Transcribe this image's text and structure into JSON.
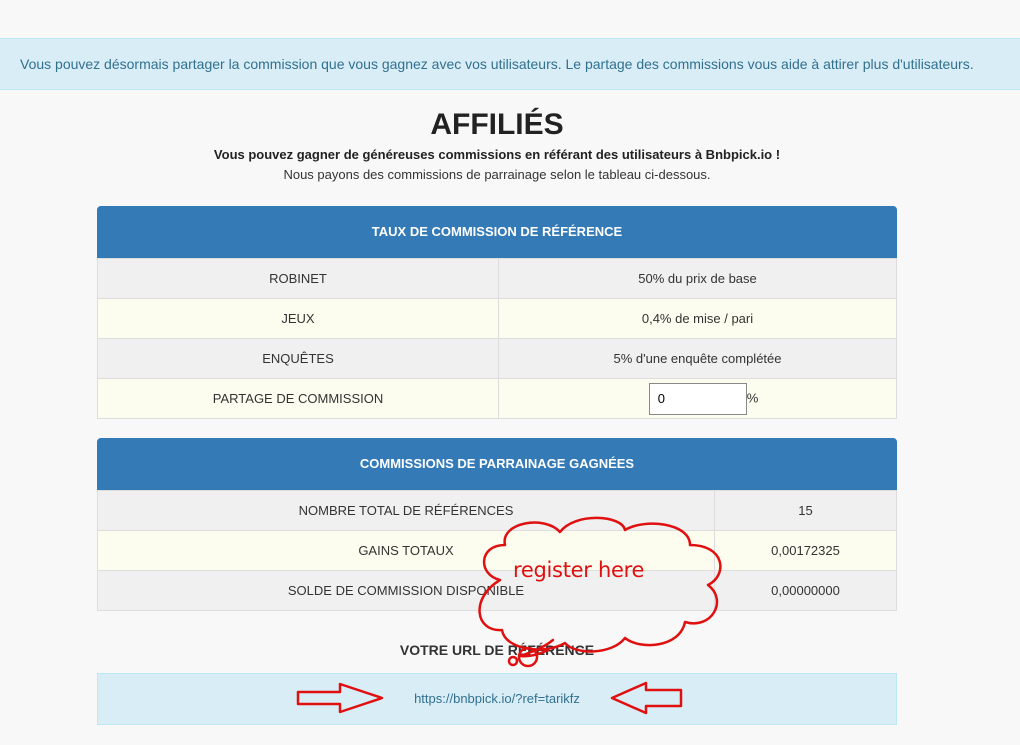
{
  "notice": {
    "text": "Vous pouvez désormais partager la commission que vous gagnez avec vos utilisateurs. Le partage des commissions vous aide à attirer plus d'utilisateurs."
  },
  "header": {
    "title": "AFFILIÉS",
    "subtitle_strong": "Vous pouvez gagner de généreuses commissions en référant des utilisateurs à Bnbpick.io !",
    "subtitle": "Nous payons des commissions de parrainage selon le tableau ci-dessous."
  },
  "rates_panel": {
    "heading": "TAUX DE COMMISSION DE RÉFÉRENCE",
    "rows": [
      {
        "label": "ROBINET",
        "value": "50% du prix de base"
      },
      {
        "label": "JEUX",
        "value": "0,4% de mise / pari"
      },
      {
        "label": "ENQUÊTES",
        "value": "5% d'une enquête complétée"
      }
    ],
    "share_label": "PARTAGE DE COMMISSION",
    "share_value": "0",
    "share_unit": "%"
  },
  "earnings_panel": {
    "heading": "COMMISSIONS DE PARRAINAGE GAGNÉES",
    "rows": [
      {
        "label": "NOMBRE TOTAL DE RÉFÉRENCES",
        "value": "15"
      },
      {
        "label": "GAINS TOTAUX",
        "value": "0,00172325"
      },
      {
        "label": "SOLDE DE COMMISSION DISPONIBLE",
        "value": "0,00000000"
      }
    ]
  },
  "referral": {
    "label": "VOTRE URL DE RÉFÉRENCE",
    "url": "https://bnbpick.io/?ref=tarikfz"
  },
  "annotation": {
    "cloud_text": "register here",
    "color": "#e01010"
  },
  "colors": {
    "panel_header": "#337ab7",
    "notice_bg": "#d9edf7",
    "notice_text": "#31708f"
  }
}
